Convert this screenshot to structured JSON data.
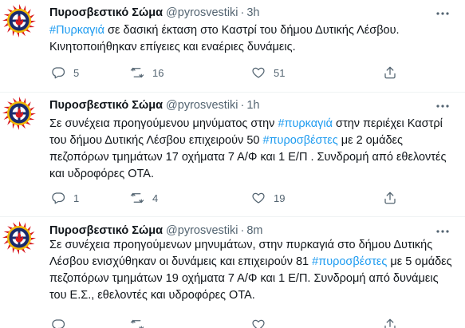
{
  "tweets": [
    {
      "name": "Πυροσβεστικό Σώμα",
      "handle": "@pyrosvestiki",
      "separator": "·",
      "time": "3h",
      "text_parts": [
        {
          "t": "#Πυρκαγιά",
          "tag": true
        },
        {
          "t": " σε δασική έκταση στο Καστρί  του δήμου Δυτικής Λέσβου. Κινητοποιήθηκαν επίγειες και εναέριες δυνάμεις.",
          "tag": false
        }
      ],
      "replies": "5",
      "retweets": "16",
      "likes": "51"
    },
    {
      "name": "Πυροσβεστικό Σώμα",
      "handle": "@pyrosvestiki",
      "separator": "·",
      "time": "1h",
      "text_parts": [
        {
          "t": "Σε συνέχεια προηγούμενου μηνύματος στην ",
          "tag": false
        },
        {
          "t": "#πυρκαγιά",
          "tag": true
        },
        {
          "t": " στην περιέχει Καστρί του δήμου Δυτικής Λέσβου επιχειρούν 50 ",
          "tag": false
        },
        {
          "t": "#πυροσβέστες",
          "tag": true
        },
        {
          "t": " με 2 ομάδες πεζοπόρων τμημάτων 17 οχήματα 7 Α/Φ και 1 Ε/Π . Συνδρομή από εθελοντές και υδροφόρες ΟΤΑ.",
          "tag": false
        }
      ],
      "replies": "1",
      "retweets": "4",
      "likes": "19"
    },
    {
      "name": "Πυροσβεστικό Σώμα",
      "handle": "@pyrosvestiki",
      "separator": "·",
      "time": "8m",
      "text_parts": [
        {
          "t": "Σε συνέχεια προηγούμενων  μηνυμάτων, στην πυρκαγιά στο  δήμου Δυτικής Λέσβου ενισχύθηκαν οι δυνάμεις και επιχειρούν 81 ",
          "tag": false
        },
        {
          "t": "#πυροσβέστες",
          "tag": true
        },
        {
          "t": " με 5 ομάδες πεζοπόρων τμημάτων 19 οχήματα 7 Α/Φ και 1 Ε/Π. Συνδρομή  από δυνάμεις του Ε.Σ., εθελοντές και υδροφόρες ΟΤΑ.",
          "tag": false
        }
      ],
      "replies": "",
      "retweets": "",
      "likes": ""
    }
  ],
  "icons": {
    "avatar": "fire-service-emblem-icon",
    "more": "more-dots-icon",
    "reply": "reply-icon",
    "retweet": "retweet-icon",
    "like": "heart-icon",
    "share": "share-icon"
  },
  "colors": {
    "hashtag": "#1d9bf0",
    "muted": "#536471",
    "text": "#0f1419",
    "divider": "#eff3f4",
    "emblem_red": "#d7191f",
    "emblem_navy": "#1a2b6d",
    "emblem_gold": "#f2b705"
  }
}
